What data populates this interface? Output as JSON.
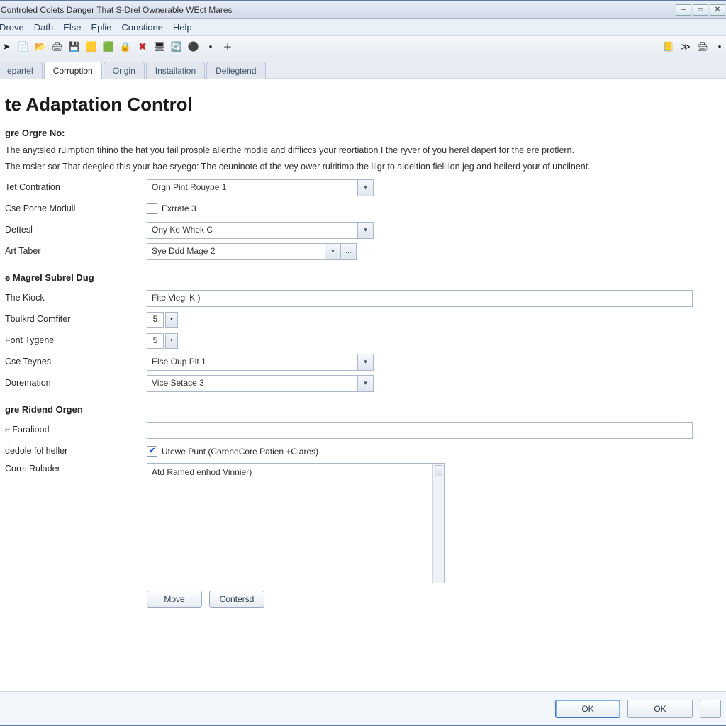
{
  "window": {
    "title": "Controled Colets Danger That S-Drel Ownerable WEct Mares"
  },
  "menu": {
    "items": [
      "Drove",
      "Dath",
      "Else",
      "Eplie",
      "Constione",
      "Help"
    ]
  },
  "toolbar_icons": [
    "➤",
    "📄",
    "📂",
    "🖨",
    "💾",
    "🟨",
    "🟩",
    "🔒",
    "✖",
    "🖥",
    "🔄",
    "⚫",
    "•",
    "＋"
  ],
  "toolbar_right_icons": [
    "📒",
    "≫",
    "🖨",
    "•"
  ],
  "tabs": [
    {
      "label": "epartel",
      "active": false
    },
    {
      "label": "Corruption",
      "active": true
    },
    {
      "label": "Origin",
      "active": false
    },
    {
      "label": "Installation",
      "active": false
    },
    {
      "label": "Deliegtend",
      "active": false
    }
  ],
  "page": {
    "title": "te Adaptation Control",
    "section1_head": "gre Orgre No:",
    "para1": "The anytsled rulmption tihino the hat you fail prosple allerthe modie and diffliccs your reortiation I the ryver of you herel dapert for the ere protlern.",
    "para2": "The rosler-sor That deegled this your hae sryego: The ceuninote of the vey ower rulritimp the lilgr to aldeltion fiellilon jeg and heilerd your of uncilnent."
  },
  "form1": {
    "rows": [
      {
        "label": "Tet Contration",
        "type": "select",
        "value": "Orgn Pint Rouype 1"
      },
      {
        "label": "Cse Porne Moduil",
        "type": "check",
        "value": "Exrrate 3",
        "checked": false
      },
      {
        "label": "Dettesl",
        "type": "select",
        "value": "Ony Ke Whek C"
      },
      {
        "label": "Art Taber",
        "type": "select2",
        "value": "Sye Ddd Mage 2"
      }
    ]
  },
  "section2_head": "e Magrel Subrel Dug",
  "form2": {
    "rows": [
      {
        "label": "The Kiock",
        "type": "text",
        "value": "Fite Viegi K )"
      },
      {
        "label": "Tbulkrd Comfiter",
        "type": "stepper",
        "value": "5"
      },
      {
        "label": "Font Tygene",
        "type": "stepper",
        "value": "5"
      },
      {
        "label": "Cse Teynes",
        "type": "select",
        "value": "Else Oup Plt 1"
      },
      {
        "label": "Doremation",
        "type": "select",
        "value": "Vice Setace 3"
      }
    ]
  },
  "section3_head": "gre Ridend Orgen",
  "form3": {
    "rows": [
      {
        "label": "e Faraliood",
        "type": "text",
        "value": ""
      },
      {
        "label": "dedole fol heller",
        "type": "check",
        "value": "Utewe Punt (CoreneCore Patien +Clares)",
        "checked": true
      },
      {
        "label": "Corrs Rulader",
        "type": "textarea",
        "value": "Atd Ramed enhod Vinnier)"
      }
    ]
  },
  "list_buttons": {
    "left": "Move",
    "right": "Contersd"
  },
  "footer": {
    "ok": "OK",
    "alt": "OK",
    "third": ""
  }
}
